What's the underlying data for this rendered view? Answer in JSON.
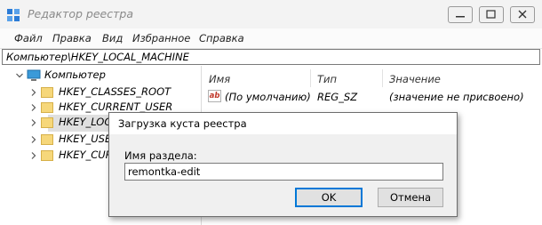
{
  "window": {
    "title": "Редактор реестра",
    "icon": "registry-editor-icon",
    "controls": [
      "minimize-icon",
      "maximize-icon",
      "close-icon"
    ]
  },
  "menu": {
    "items": [
      "Файл",
      "Правка",
      "Вид",
      "Избранное",
      "Справка"
    ]
  },
  "address": {
    "path": "Компьютер\\HKEY_LOCAL_MACHINE"
  },
  "tree": {
    "root": {
      "label": "Компьютер",
      "icon": "computer-icon"
    },
    "items": [
      {
        "label": "HKEY_CLASSES_ROOT"
      },
      {
        "label": "HKEY_CURRENT_USER"
      },
      {
        "label": "HKEY_LOC",
        "selected": true
      },
      {
        "label": "HKEY_USER"
      },
      {
        "label": "HKEY_CUR"
      }
    ]
  },
  "values_pane": {
    "columns": [
      "Имя",
      "Тип",
      "Значение"
    ],
    "rows": [
      {
        "name": "(По умолчанию)",
        "type": "REG_SZ",
        "data": "(значение не присвоено)",
        "icon": "string-value-icon",
        "icon_text": "ab"
      }
    ]
  },
  "dialog": {
    "title": "Загрузка куста реестра",
    "field_label": "Имя раздела:",
    "field_value": "remontka-edit",
    "ok_label": "OK",
    "cancel_label": "Отмена"
  },
  "colors": {
    "accent": "#0078d7",
    "folder": "#f6d77a",
    "selection": "#e0e0e0"
  }
}
